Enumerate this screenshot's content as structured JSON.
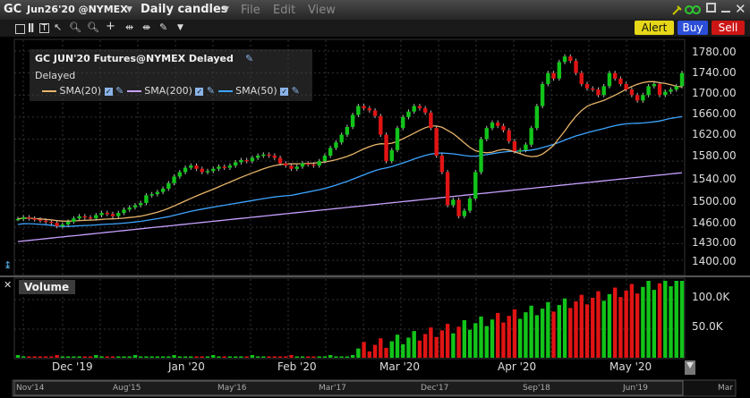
{
  "titlebar": {
    "symbol": "GC",
    "contract": "Jun26'20 @NYMEX",
    "bar_type": "Daily candles",
    "menus": [
      "File",
      "Edit",
      "View"
    ],
    "buttons": {
      "alert": "Alert",
      "buy": "Buy",
      "sell": "Sell"
    }
  },
  "legend": {
    "title": "GC JUN'20 Futures@NYMEX Delayed",
    "status": "Delayed",
    "sma20": "SMA(20)",
    "sma200": "SMA(200)",
    "sma50": "SMA(50)",
    "colors": {
      "sma20": "#e8b46a",
      "sma200": "#c8a0ff",
      "sma50": "#3da4ff",
      "up": "#12c41a",
      "down": "#e01414"
    }
  },
  "volume_panel": {
    "title": "Volume"
  },
  "price_axis": [
    "1780.00",
    "1740.00",
    "1700.00",
    "1660.00",
    "1620.00",
    "1580.00",
    "1540.00",
    "1500.00",
    "1460.00",
    "1430.00",
    "1400.00"
  ],
  "volume_axis": [
    "100.0K",
    "50.0K"
  ],
  "time_axis": [
    "Dec '19",
    "Jan '20",
    "Feb '20",
    "Mar '20",
    "Apr '20",
    "May '20"
  ],
  "navigator_axis": [
    "Nov'14",
    "Aug'15",
    "May'16",
    "Mar'17",
    "Dec'17",
    "Sep'18",
    "Jun'19",
    "Mar"
  ],
  "chart_data": {
    "type": "candlestick",
    "ylim": [
      1400,
      1800
    ],
    "volume_ylim": [
      0,
      130000
    ]
  }
}
